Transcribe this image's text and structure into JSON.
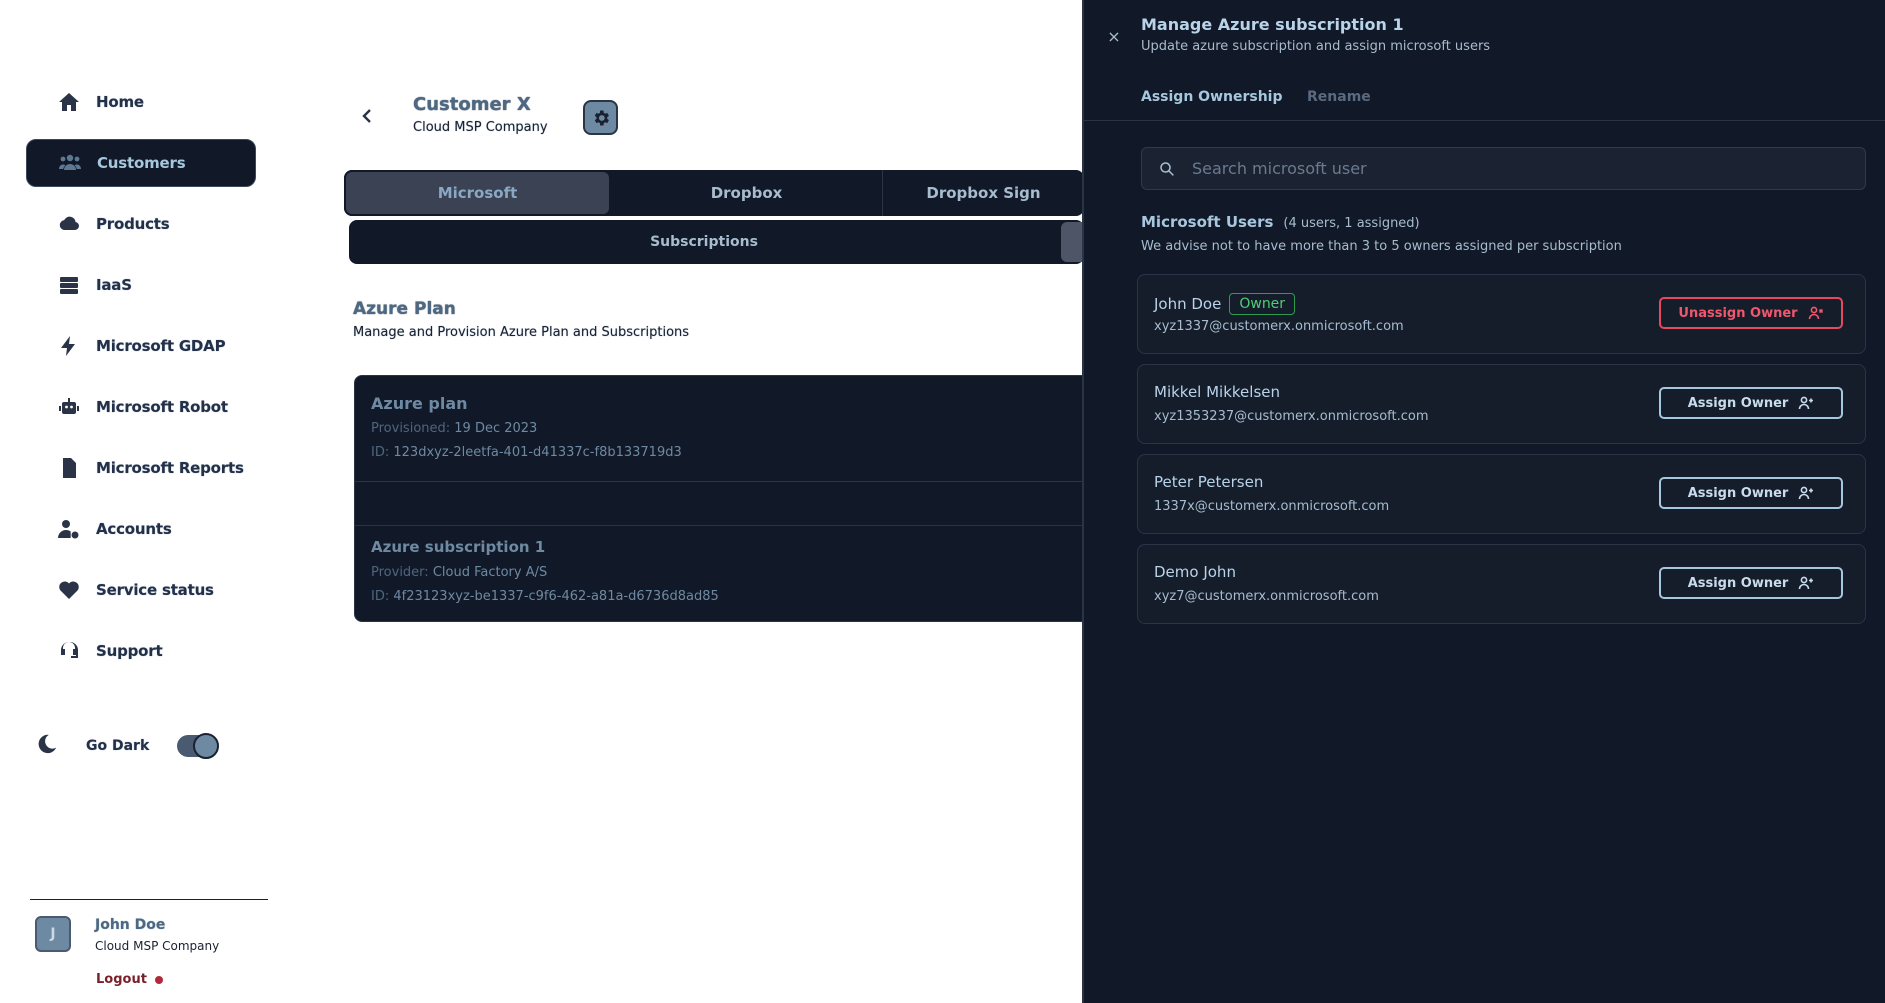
{
  "sidebar": {
    "items": [
      {
        "label": "Home",
        "icon": "home-icon"
      },
      {
        "label": "Customers",
        "icon": "users-icon"
      },
      {
        "label": "Products",
        "icon": "cloud-icon"
      },
      {
        "label": "IaaS",
        "icon": "server-icon"
      },
      {
        "label": "Microsoft GDAP",
        "icon": "bolt-icon"
      },
      {
        "label": "Microsoft Robot",
        "icon": "robot-icon"
      },
      {
        "label": "Microsoft Reports",
        "icon": "file-icon"
      },
      {
        "label": "Accounts",
        "icon": "user-gear-icon"
      },
      {
        "label": "Service status",
        "icon": "heart-pulse-icon"
      },
      {
        "label": "Support",
        "icon": "headset-icon"
      }
    ],
    "active_index": 1,
    "dark_mode_label": "Go Dark",
    "dark_mode_on": true,
    "user": {
      "initial": "J",
      "name": "John Doe",
      "company": "Cloud MSP Company",
      "logout_label": "Logout"
    }
  },
  "customer": {
    "name": "Customer X",
    "company": "Cloud MSP Company"
  },
  "vendor_tabs": [
    "Microsoft",
    "Dropbox",
    "Dropbox Sign"
  ],
  "active_vendor_tab": 0,
  "sub_tabs": [
    "Subscriptions"
  ],
  "section": {
    "title": "Azure Plan",
    "subtitle": "Manage and Provision Azure Plan and Subscriptions"
  },
  "plan": {
    "name": "Azure plan",
    "provisioned_label": "Provisioned:",
    "provisioned_value": "19 Dec 2023",
    "id_label": "ID:",
    "id_value": "123dxyz-2leetfa-401-d41337c-f8b133719d3"
  },
  "subscription": {
    "name": "Azure subscription 1",
    "provider_label": "Provider:",
    "provider_value": "Cloud Factory A/S",
    "id_label": "ID:",
    "id_value": "4f23123xyz-be1337-c9f6-462-a81a-d6736d8ad85"
  },
  "drawer": {
    "close_glyph": "×",
    "title": "Manage Azure subscription 1",
    "subtitle": "Update azure subscription and assign microsoft users",
    "tabs": [
      "Assign Ownership",
      "Rename"
    ],
    "active_tab": 0,
    "search_placeholder": "Search microsoft user",
    "users_title": "Microsoft Users",
    "users_count": "(4 users, 1 assigned)",
    "users_advice": "We advise not to have more than 3 to 5 owners assigned per subscription",
    "users": [
      {
        "name": "John Doe",
        "badge": "Owner",
        "email": "xyz1337@customerx.onmicrosoft.com",
        "action": "Unassign Owner",
        "assigned": true
      },
      {
        "name": "Mikkel Mikkelsen",
        "badge": "",
        "email": "xyz1353237@customerx.onmicrosoft.com",
        "action": "Assign Owner",
        "assigned": false
      },
      {
        "name": "Peter Petersen",
        "badge": "",
        "email": "1337x@customerx.onmicrosoft.com",
        "action": "Assign Owner",
        "assigned": false
      },
      {
        "name": "Demo John",
        "badge": "",
        "email": "xyz7@customerx.onmicrosoft.com",
        "action": "Assign Owner",
        "assigned": false
      }
    ]
  },
  "colors": {
    "sidebar_active_bg": "#111827",
    "drawer_bg": "#111827",
    "owner_badge": "#4fcf74",
    "danger": "#f0576c",
    "accent": "#a7c7df"
  }
}
